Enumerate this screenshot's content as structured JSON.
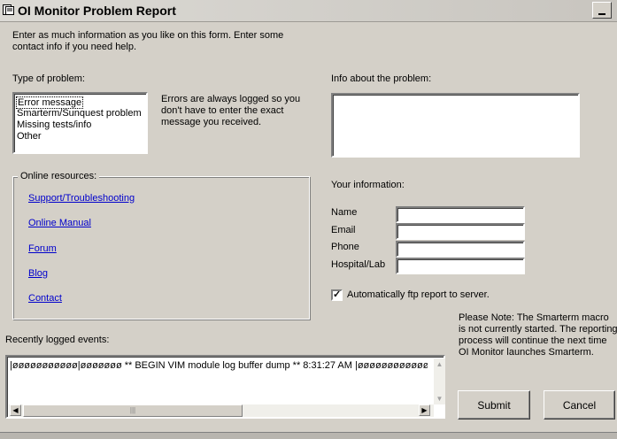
{
  "window": {
    "title": "OI Monitor Problem Report",
    "icon": "report-icon"
  },
  "intro": {
    "line1": "Enter as much information as you like on this form.  Enter some",
    "line2": "contact info if you need help."
  },
  "problem_type": {
    "label": "Type of problem:",
    "options": [
      "Error message",
      "Smarterm/Sunquest problem",
      "Missing tests/info",
      "Other"
    ],
    "selected": "Error message",
    "hint_line1": "Errors are always logged so you",
    "hint_line2": "don't have to enter the exact",
    "hint_line3": "message you received."
  },
  "info": {
    "label": "Info about the problem:",
    "value": ""
  },
  "resources": {
    "label": "Online resources:",
    "links": [
      "Support/Troubleshooting",
      "Online Manual",
      "Forum",
      "Blog",
      "Contact"
    ]
  },
  "your_info": {
    "label": "Your information:",
    "fields": [
      {
        "label": "Name",
        "value": ""
      },
      {
        "label": "Email",
        "value": ""
      },
      {
        "label": "Phone",
        "value": ""
      },
      {
        "label": "Hospital/Lab",
        "value": ""
      }
    ]
  },
  "ftp": {
    "label": "Automatically ftp report to server.",
    "checked": true
  },
  "note": "Please Note: The Smarterm macro is not currently started.  The reporting process will continue the next time OI Monitor launches Smarterm.",
  "events": {
    "label": "Recently logged events:",
    "text": "|øøøøøøøøøøø|øøøøøøø ** BEGIN VIM module log buffer dump ** 8:31:27 AM |øøøøøøøøøøøøøøøøø"
  },
  "buttons": {
    "submit": "Submit",
    "cancel": "Cancel"
  }
}
